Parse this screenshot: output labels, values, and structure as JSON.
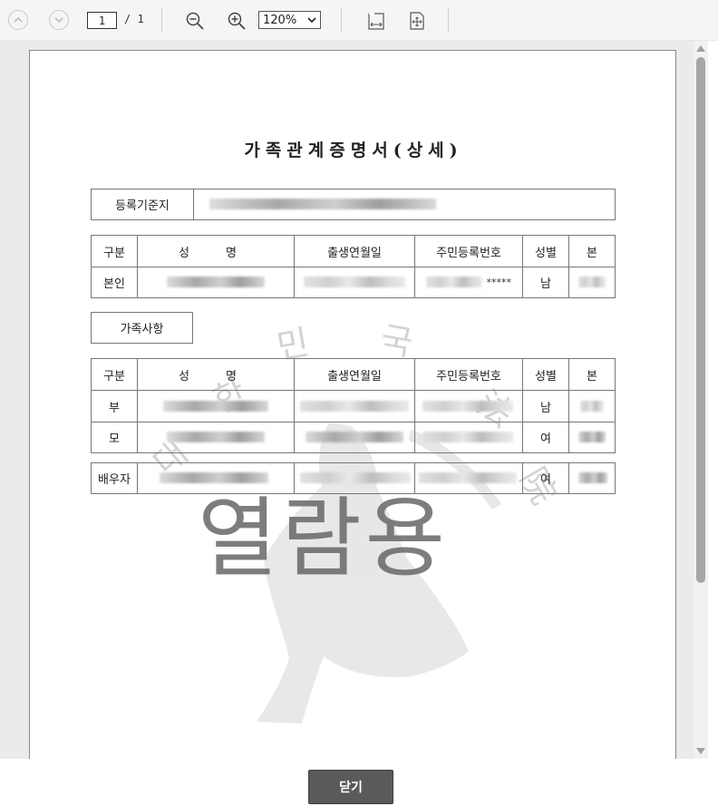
{
  "toolbar": {
    "current_page": "1",
    "total_pages": "/ 1",
    "zoom": "120%",
    "icons": [
      "chevron-up-icon",
      "chevron-down-icon",
      "zoom-out-icon",
      "zoom-in-icon",
      "fit-width-icon",
      "fit-page-icon"
    ]
  },
  "document": {
    "title": "가족관계증명서(상세)",
    "registry_label": "등록기준지",
    "table_headers": [
      "구분",
      "성 명",
      "출생연월일",
      "주민등록번호",
      "성별",
      "본"
    ],
    "self_row": {
      "relation": "본인",
      "id_suffix": "*****",
      "gender": "남"
    },
    "family_section_label": "가족사항",
    "family_rows": [
      {
        "relation": "부",
        "gender": "남"
      },
      {
        "relation": "모",
        "gender": "여"
      }
    ],
    "spouse_row": {
      "relation": "배우자",
      "gender": "여"
    },
    "watermark_text": "열람용",
    "seal_text": "대한민국"
  },
  "footer": {
    "close_label": "닫기"
  },
  "colors": {
    "toolbar_bg": "#f5f5f5",
    "viewer_bg": "#ebebeb",
    "close_button_bg": "#5a5a5a"
  }
}
